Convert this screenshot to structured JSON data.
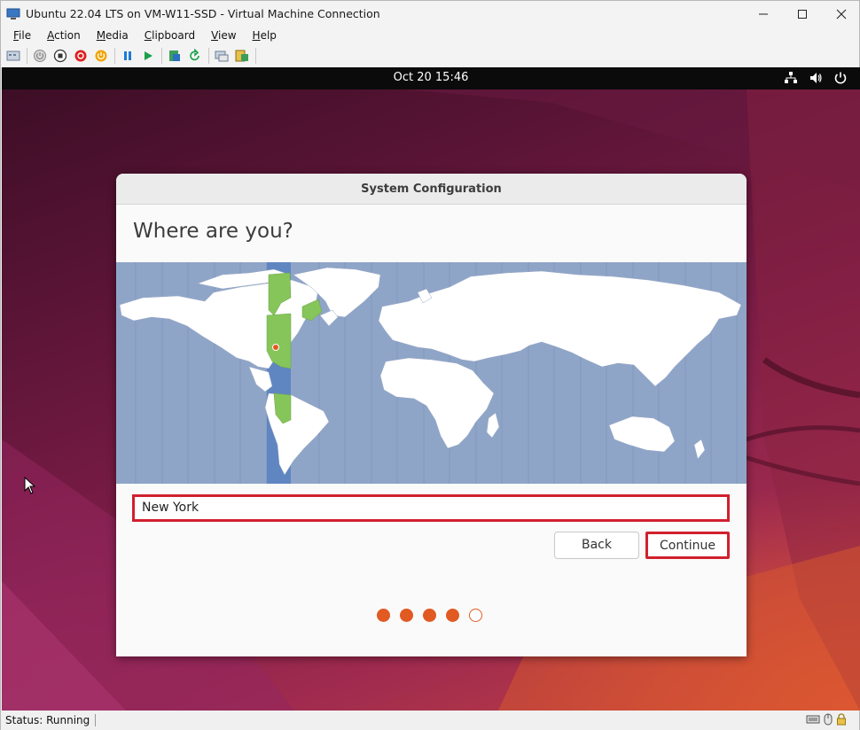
{
  "window": {
    "title": "Ubuntu 22.04 LTS on VM-W11-SSD - Virtual Machine Connection"
  },
  "window_controls": [
    "minimize-icon",
    "maximize-icon",
    "close-icon"
  ],
  "menu": [
    {
      "label": "File",
      "u": "F",
      "rest": "ile"
    },
    {
      "label": "Action",
      "u": "A",
      "rest": "ction"
    },
    {
      "label": "Media",
      "u": "M",
      "rest": "edia"
    },
    {
      "label": "Clipboard",
      "u": "C",
      "rest": "lipboard"
    },
    {
      "label": "View",
      "u": "V",
      "rest": "iew"
    },
    {
      "label": "Help",
      "u": "H",
      "rest": "elp"
    }
  ],
  "toolbar_icons": [
    "ctrl-alt-del-icon",
    "start-icon",
    "turn-off-icon",
    "shut-down-icon",
    "save-icon",
    "pause-icon",
    "resume-icon",
    "checkpoint-icon",
    "revert-icon",
    "enhanced-session-icon",
    "share-icon"
  ],
  "gnome": {
    "clock": "Oct 20  15:46",
    "icons": [
      "network-icon",
      "volume-icon",
      "power-icon"
    ]
  },
  "dialog": {
    "title": "System Configuration",
    "heading": "Where are you?",
    "location_value": "New York",
    "back_label": "Back",
    "continue_label": "Continue",
    "steps_total": 5,
    "steps_done": 4
  },
  "colors": {
    "accent": "#e05a22",
    "highlight": "#d1202e",
    "ocean": "#8fa5c8",
    "selected_zone": "#5f86c1",
    "zone_land": "#86c55a"
  },
  "status": {
    "text": "Status: Running"
  }
}
